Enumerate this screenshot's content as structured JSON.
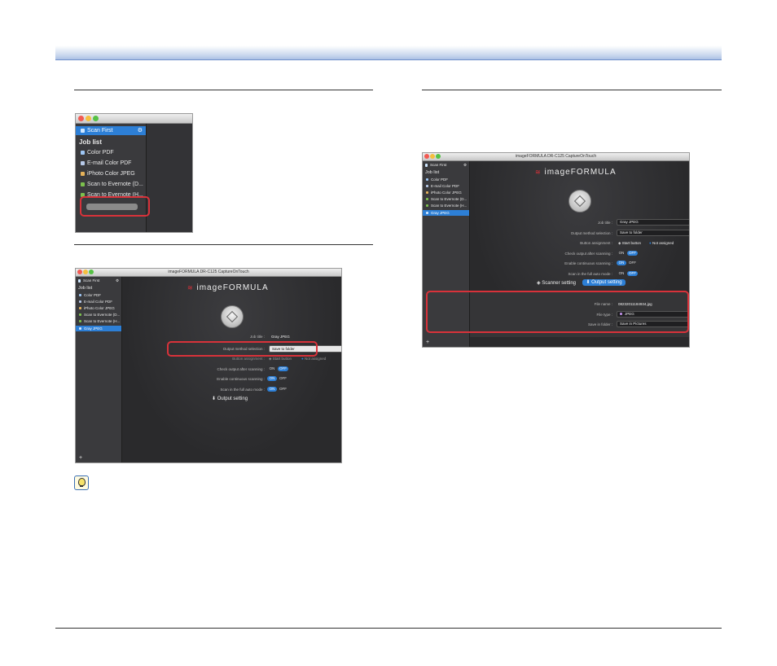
{
  "window_title": "imageFORMULA DR-C125 CaptureOnTouch",
  "logo_text": "imageFORMULA",
  "sidebar": {
    "scan_first": "Scan First",
    "job_list": "Job list",
    "jobs_small": [
      "Color PDF",
      "E-mail Color PDF",
      "iPhoto Color JPEG",
      "Scan to Evernote (D...",
      "Scan to Evernote (H...",
      "Gray JPEG"
    ],
    "jobs_win2": [
      "Color PDF",
      "E-mail Color PDF",
      "iPhoto Color JPEG",
      "Scan to Evernote (D...",
      "Scan to Evernote (H...",
      "Gray JPEG"
    ],
    "add_symbol": "+"
  },
  "settings": {
    "job_title_label": "Job title :",
    "job_title_value": "Gray JPEG",
    "output_method_label": "Output method selection :",
    "output_method_value": "Save to folder",
    "button_assignment_label": "Button assignment :",
    "start_button": "Start button",
    "not_assigned": "Not assigned",
    "check_output_label": "Check output after scanning :",
    "continuous_label": "Enable continuous scanning :",
    "full_auto_label": "Scan in the full auto mode :",
    "on": "ON",
    "off": "OFF",
    "scanner_setting": "Scanner setting",
    "output_setting": "Output setting"
  },
  "output": {
    "file_name_label": "File name :",
    "file_name_value": "08232011184934.jpg",
    "file_type_label": "File type :",
    "file_type_value": "JPEG",
    "save_folder_label": "Save in folder :",
    "save_folder_value": "Save in Pictures"
  },
  "colors": {
    "accent": "#2d7fd6",
    "highlight": "#d8323a",
    "header": "#a6bde3"
  }
}
